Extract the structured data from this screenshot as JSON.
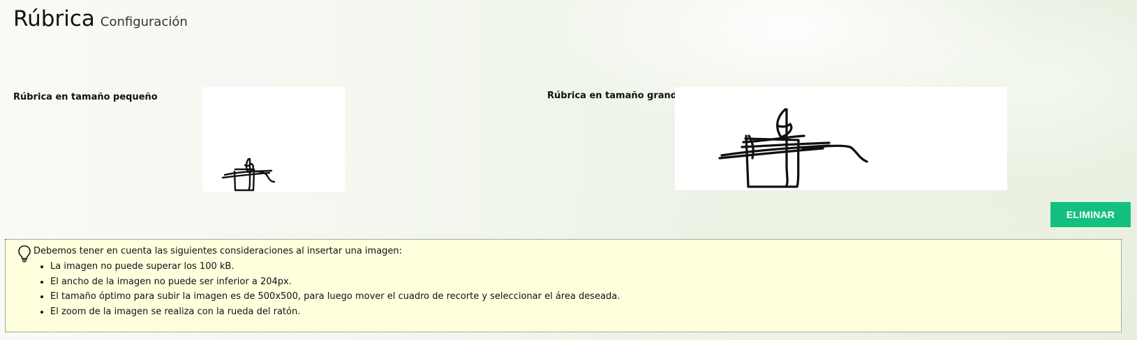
{
  "header": {
    "title": "Rúbrica",
    "subtitle": "Configuración"
  },
  "signatures": {
    "small_label": "Rúbrica en tamaño pequeño",
    "large_label": "Rúbrica en tamaño grande"
  },
  "actions": {
    "delete_label": "ELIMINAR"
  },
  "notice": {
    "intro": "Debemos tener en cuenta las siguientes consideraciones al insertar una imagen:",
    "items": [
      "La imagen no puede superar los 100 kB.",
      "El ancho de la imagen no puede ser inferior a 204px.",
      "El tamaño óptimo para subir la imagen es de 500x500, para luego mover el cuadro de recorte y seleccionar el área deseada.",
      "El zoom de la imagen se realiza con la rueda del ratón."
    ]
  },
  "icons": {
    "notice": "lightbulb-icon"
  },
  "colors": {
    "accent": "#14c07f",
    "notice_background": "#ffffde"
  }
}
